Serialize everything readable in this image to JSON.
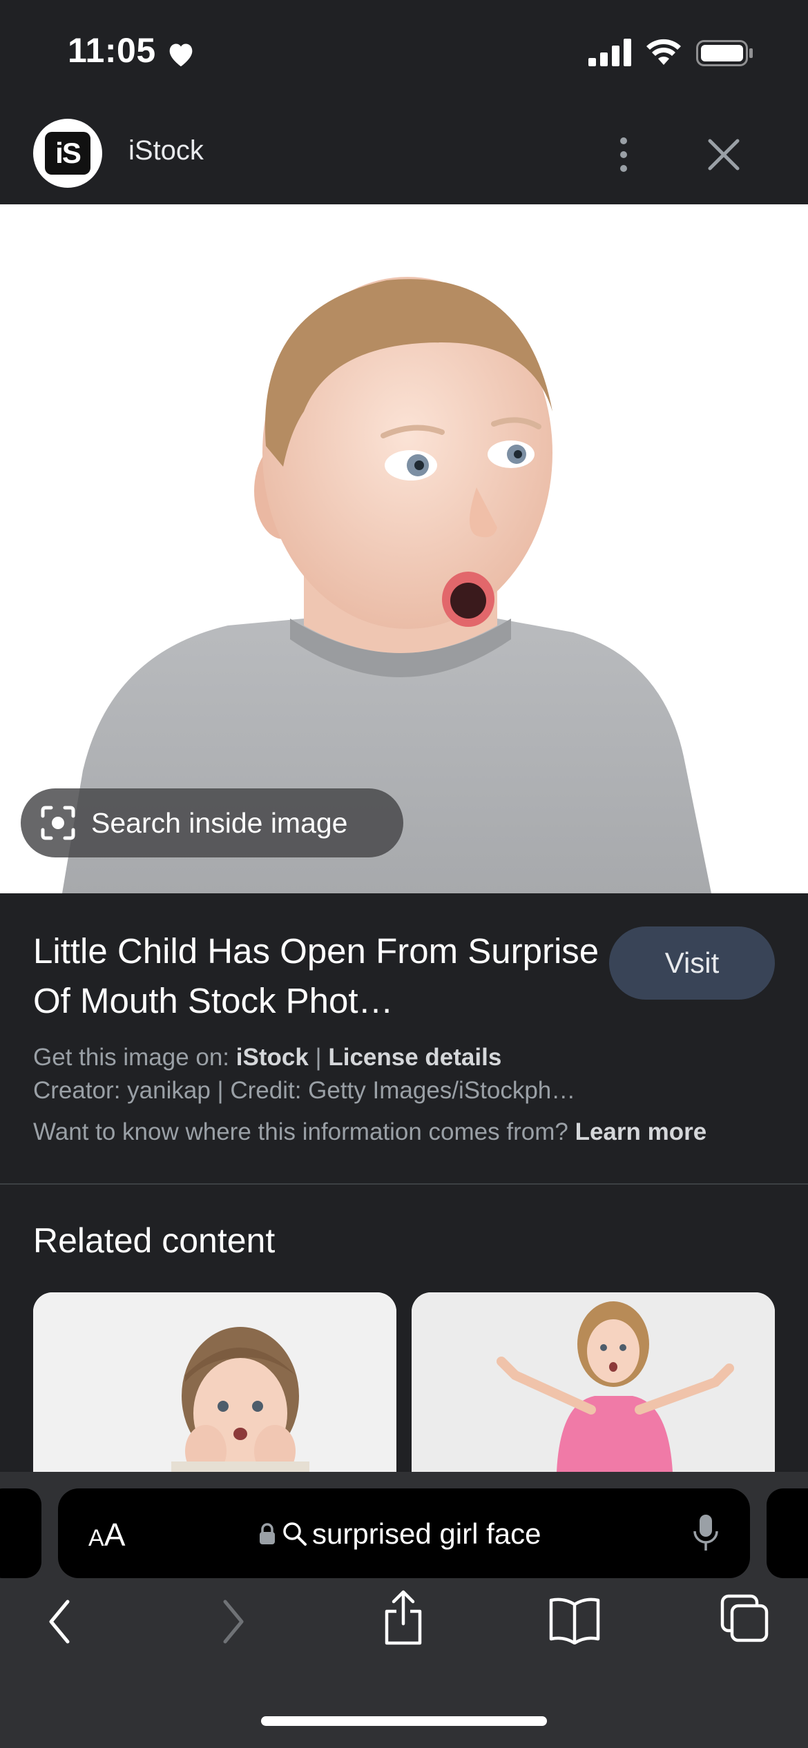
{
  "status_bar": {
    "time": "11:05",
    "icons": [
      "heart-icon",
      "cellular-signal-icon",
      "wifi-icon",
      "battery-icon"
    ]
  },
  "header": {
    "logo_text": "iS",
    "site_name": "iStock",
    "icons": [
      "more-vert-icon",
      "close-icon"
    ]
  },
  "image_viewer": {
    "search_inside_label": "Search inside image",
    "icons": [
      "lens-icon"
    ]
  },
  "result": {
    "title": "Little Child Has Open From Surprise Of Mouth Stock Phot…",
    "visit_label": "Visit",
    "get_image_prefix": "Get this image on: ",
    "get_image_source": "iStock",
    "separator": " | ",
    "license_label": "License details",
    "creator_line": "Creator: yanikap | Credit: Getty Images/iStockph…",
    "info_question": "Want to know where this information comes from? ",
    "learn_more": "Learn more"
  },
  "related": {
    "heading": "Related content"
  },
  "browser": {
    "aa_big": "A",
    "aa_small": "A",
    "address_text": "surprised girl face",
    "icons": [
      "lock-icon",
      "search-icon",
      "microphone-icon",
      "back-icon",
      "forward-icon",
      "share-icon",
      "bookmarks-icon",
      "tabs-icon"
    ]
  }
}
